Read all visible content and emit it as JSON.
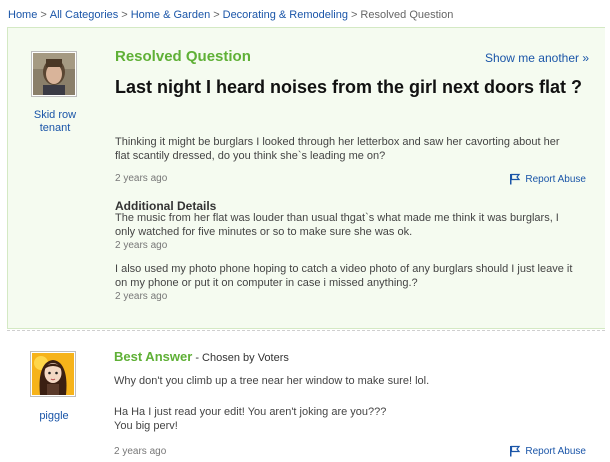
{
  "breadcrumb": {
    "items": [
      "Home",
      "All Categories",
      "Home & Garden",
      "Decorating & Remodeling"
    ],
    "current": "Resolved Question",
    "separator": ">"
  },
  "question": {
    "status_label": "Resolved Question",
    "show_another": "Show me another »",
    "asker": {
      "line1": "Skid row",
      "line2": "tenant"
    },
    "title": "Last night I heard noises from the girl next doors flat ?",
    "body": "Thinking it might be burglars I looked through her letterbox and saw her cavorting about her flat scantily dressed, do you think she`s leading me on?",
    "time": "2 years ago",
    "report_abuse": "Report Abuse",
    "additional_details_heading": "Additional Details",
    "details": [
      {
        "text": "The music from her flat was louder than usual thgat`s what made me think it was burglars, I only watched for five minutes or so to make sure she was ok.",
        "time": "2 years ago"
      },
      {
        "text": "I also used my photo phone hoping to catch a video photo of any burglars should I just leave it on my phone or put it on computer in case i missed anything.?",
        "time": "2 years ago"
      }
    ]
  },
  "best_answer": {
    "label": "Best Answer",
    "chosen_by": " - Chosen by Voters",
    "answerer": "piggle",
    "paragraphs": [
      "Why don't you climb up a tree near her window to make sure! lol.",
      "Ha Ha I just read your edit! You aren't joking are you???",
      "You big perv!"
    ],
    "time": "2 years ago",
    "report_abuse": "Report Abuse"
  },
  "colors": {
    "link": "#1a55a8",
    "accent_green": "#5fb036",
    "panel_bg": "#f5fbf0",
    "panel_border": "#d4e9c4"
  },
  "icons": [
    "flag-icon",
    "user-avatar"
  ]
}
